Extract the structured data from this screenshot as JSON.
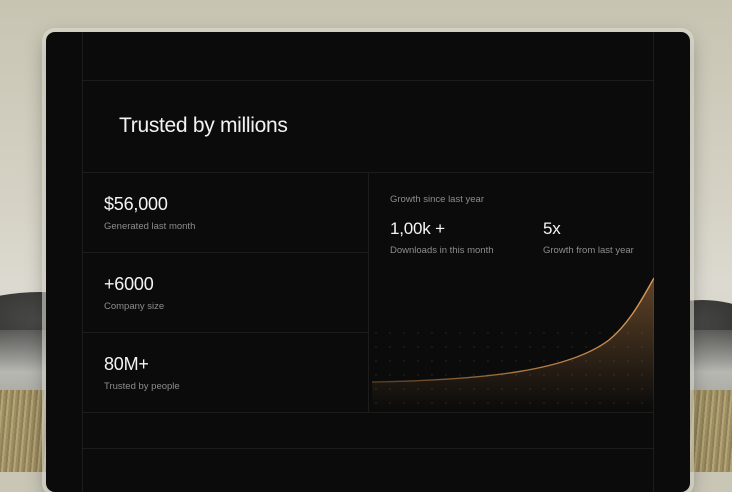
{
  "section": {
    "title": "Trusted by millions"
  },
  "stats": [
    {
      "value": "$56,000",
      "label": "Generated last month"
    },
    {
      "value": "+6000",
      "label": "Company size"
    },
    {
      "value": "80M+",
      "label": "Trusted by people"
    }
  ],
  "growth": {
    "title": "Growth since last year",
    "metrics": [
      {
        "value": "1,00k +",
        "label": "Downloads in this month"
      },
      {
        "value": "5x",
        "label": "Growth from last year"
      }
    ],
    "curve_color": "#c6884a"
  },
  "colors": {
    "card_bg": "#0b0b0b",
    "accent": "#c6884a"
  }
}
